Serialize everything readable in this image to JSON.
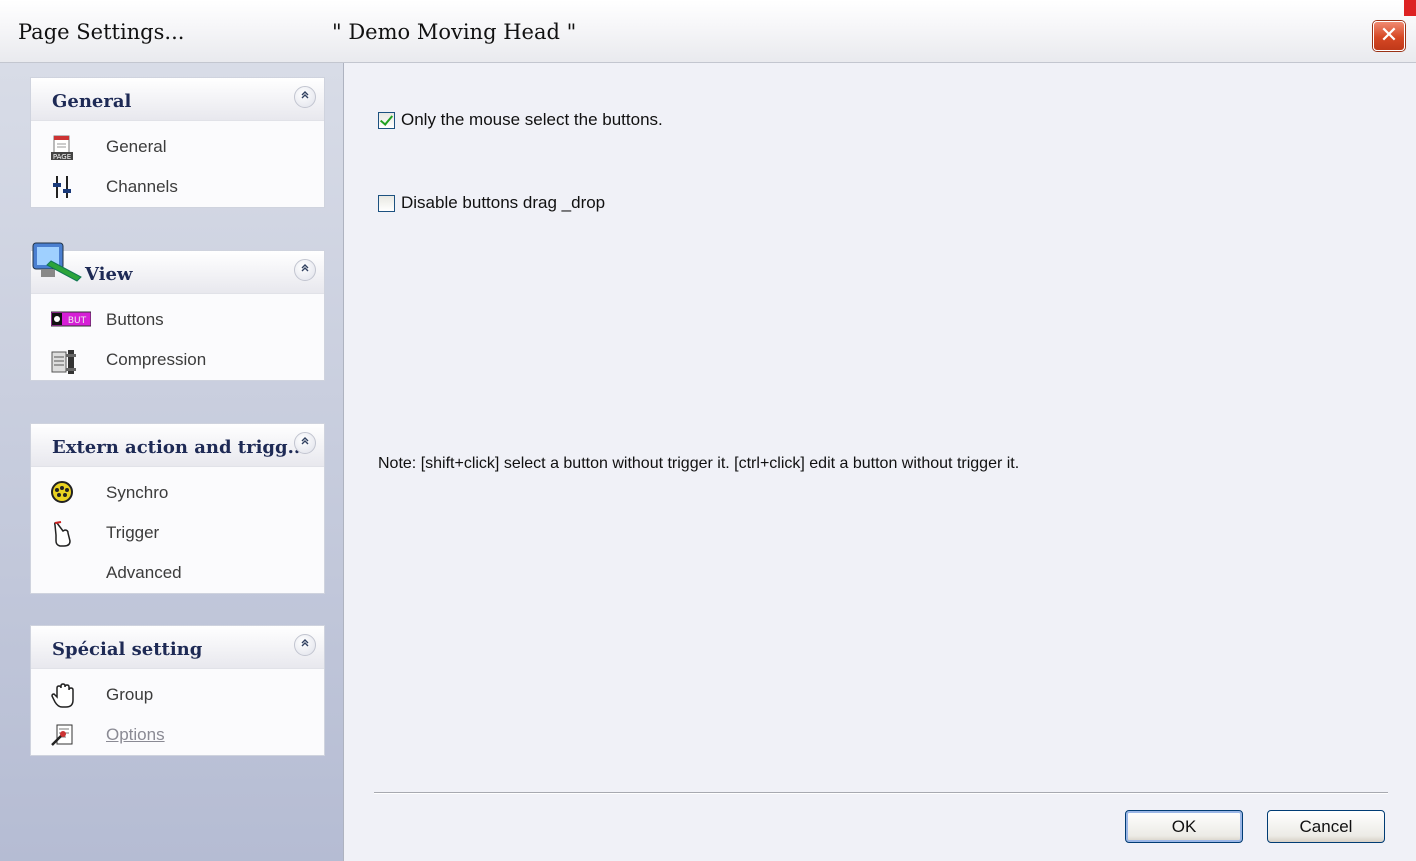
{
  "window": {
    "title_left": "Page  Settings...",
    "title_right": "\" Demo Moving Head \"",
    "close_label": "✕"
  },
  "sidebar": {
    "groups": [
      {
        "title": "General",
        "collapse_glyph": "⌃",
        "items": [
          {
            "label": "General",
            "icon": "page-icon"
          },
          {
            "label": "Channels",
            "icon": "faders-icon"
          }
        ]
      },
      {
        "title": "View",
        "collapse_glyph": "⌃",
        "items": [
          {
            "label": "Buttons",
            "icon": "button-icon"
          },
          {
            "label": "Compression",
            "icon": "compression-icon"
          }
        ]
      },
      {
        "title": "Extern action and trigg...",
        "collapse_glyph": "⌃",
        "items": [
          {
            "label": "Synchro",
            "icon": "dmx-connector-icon"
          },
          {
            "label": "Trigger",
            "icon": "hand-pointer-icon"
          },
          {
            "label": "Advanced",
            "icon": ""
          }
        ]
      },
      {
        "title": "Spécial setting",
        "collapse_glyph": "⌃",
        "items": [
          {
            "label": "Group",
            "icon": "hand-icon"
          },
          {
            "label": "Options",
            "icon": "options-icon",
            "disabled": true
          }
        ]
      }
    ]
  },
  "content": {
    "option1": {
      "label": "Only the mouse select the buttons.",
      "checked": true
    },
    "option2": {
      "label": "Disable buttons drag _drop",
      "checked": false
    },
    "note": "Note: [shift+click] select a button without trigger it.  [ctrl+click] edit a button without trigger it."
  },
  "buttons": {
    "ok": "OK",
    "cancel": "Cancel"
  },
  "colors": {
    "accent": "#1e2a55",
    "close": "#d64824",
    "check": "#21a121"
  }
}
